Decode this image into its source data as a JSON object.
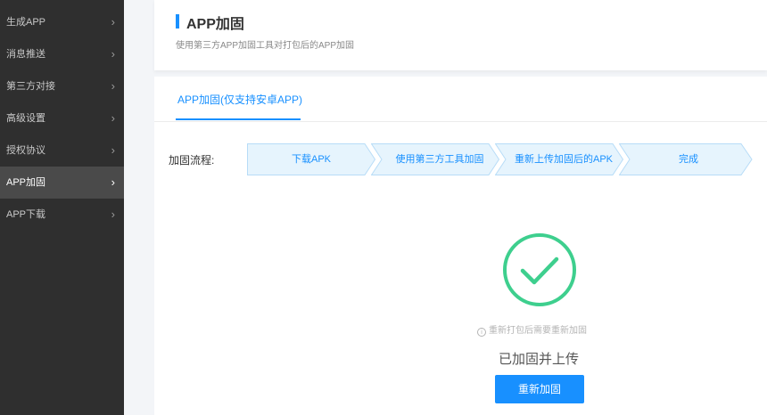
{
  "sidebar": {
    "items": [
      {
        "label": "生成APP"
      },
      {
        "label": "消息推送"
      },
      {
        "label": "第三方对接"
      },
      {
        "label": "高级设置"
      },
      {
        "label": "授权协议"
      },
      {
        "label": "APP加固"
      },
      {
        "label": "APP下载"
      }
    ],
    "active_index": 5
  },
  "header": {
    "title": "APP加固",
    "subtitle": "使用第三方APP加固工具对打包后的APP加固"
  },
  "tabs": [
    {
      "label": "APP加固(仅支持安卓APP)",
      "active": true
    }
  ],
  "process": {
    "label": "加固流程:",
    "steps": [
      {
        "label": "下载APK"
      },
      {
        "label": "使用第三方工具加固"
      },
      {
        "label": "重新上传加固后的APK"
      },
      {
        "label": "完成"
      }
    ]
  },
  "result": {
    "note_icon": "info-icon",
    "note": "重新打包后需要重新加固",
    "status": "已加固并上传",
    "button_label": "重新加固"
  },
  "colors": {
    "accent": "#1890ff",
    "success": "#3ecf8e",
    "sidebar_bg": "#2f2f2f",
    "step_fill": "#e6f4fd"
  }
}
